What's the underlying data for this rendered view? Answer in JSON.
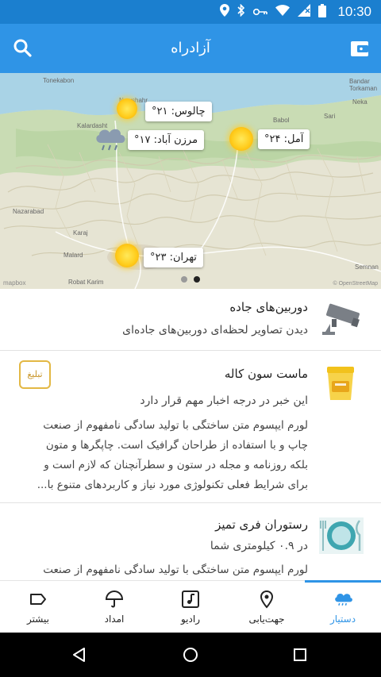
{
  "status_bar": {
    "time": "10:30"
  },
  "app_bar": {
    "title": "آزادراه"
  },
  "map": {
    "pager": {
      "count": 2,
      "active_index": 1
    },
    "logo": "mapbox",
    "attribution": "© OpenStreetMap",
    "cities": [
      "Tonekabon",
      "Kalardasht",
      "Chalus",
      "Nowshahr",
      "Babol",
      "Sari",
      "Neka",
      "Nazarabad",
      "Karaj",
      "Malard",
      "Tehran",
      "Robat Karim",
      "Semnan",
      "Bandar Torkaman"
    ],
    "callouts": [
      {
        "id": "chalus",
        "text": "چالوس: ۲۱°",
        "weather": "sunny"
      },
      {
        "id": "marzanabad",
        "text": "مرزن آباد: ۱۷°",
        "weather": "rain"
      },
      {
        "id": "amol",
        "text": "آمل: ۲۴°",
        "weather": "sunny"
      },
      {
        "id": "tehran",
        "text": "تهران: ۲۳°",
        "weather": "sunny"
      }
    ]
  },
  "cards": {
    "road_cameras": {
      "title": "دوربین‌های جاده",
      "subtitle": "دیدن تصاویر لحظه‌ای دوربین‌های جاده‌ای",
      "thumb_icon": "camera-icon"
    },
    "ad": {
      "title": "ماست سون کاله",
      "subtitle": "این خبر در درجه اخبار مهم قرار دارد",
      "badge": "تبلیغ",
      "body_lines": [
        "لورم ایپسوم متن ساختگی با تولید سادگی نامفهوم از صنعت",
        "چاپ و با استفاده از طراحان گرافیک است. چاپگرها و متون",
        "بلکه روزنامه و مجله در ستون و سطرآنچنان که لازم است و",
        "برای شرایط فعلی تکنولوژی مورد نیاز و کاربردهای متنوع با..."
      ],
      "thumb_icon": "yogurt-icon"
    },
    "restaurant": {
      "title": "رستوران فری تمیز",
      "subtitle": "در ۰.۹ کیلومتری شما",
      "body_lines": [
        "لورم ایپسوم متن ساختگی با تولید سادگی نامفهوم از صنعت"
      ],
      "thumb_icon": "plate-icon"
    }
  },
  "bottom_nav": {
    "items": [
      {
        "label": "بیشتر",
        "icon": "tag-icon"
      },
      {
        "label": "امداد",
        "icon": "umbrella-icon"
      },
      {
        "label": "رادیو",
        "icon": "music-note-icon"
      },
      {
        "label": "جهت‌یابی",
        "icon": "location-pin-icon"
      },
      {
        "label": "دستیار",
        "icon": "weather-cloud-icon",
        "active": true
      }
    ]
  },
  "colors": {
    "status_bar": "#1b7fcf",
    "app_bar": "#2f94e6",
    "accent": "#2f94e6",
    "ad_badge": "#e3b844"
  }
}
